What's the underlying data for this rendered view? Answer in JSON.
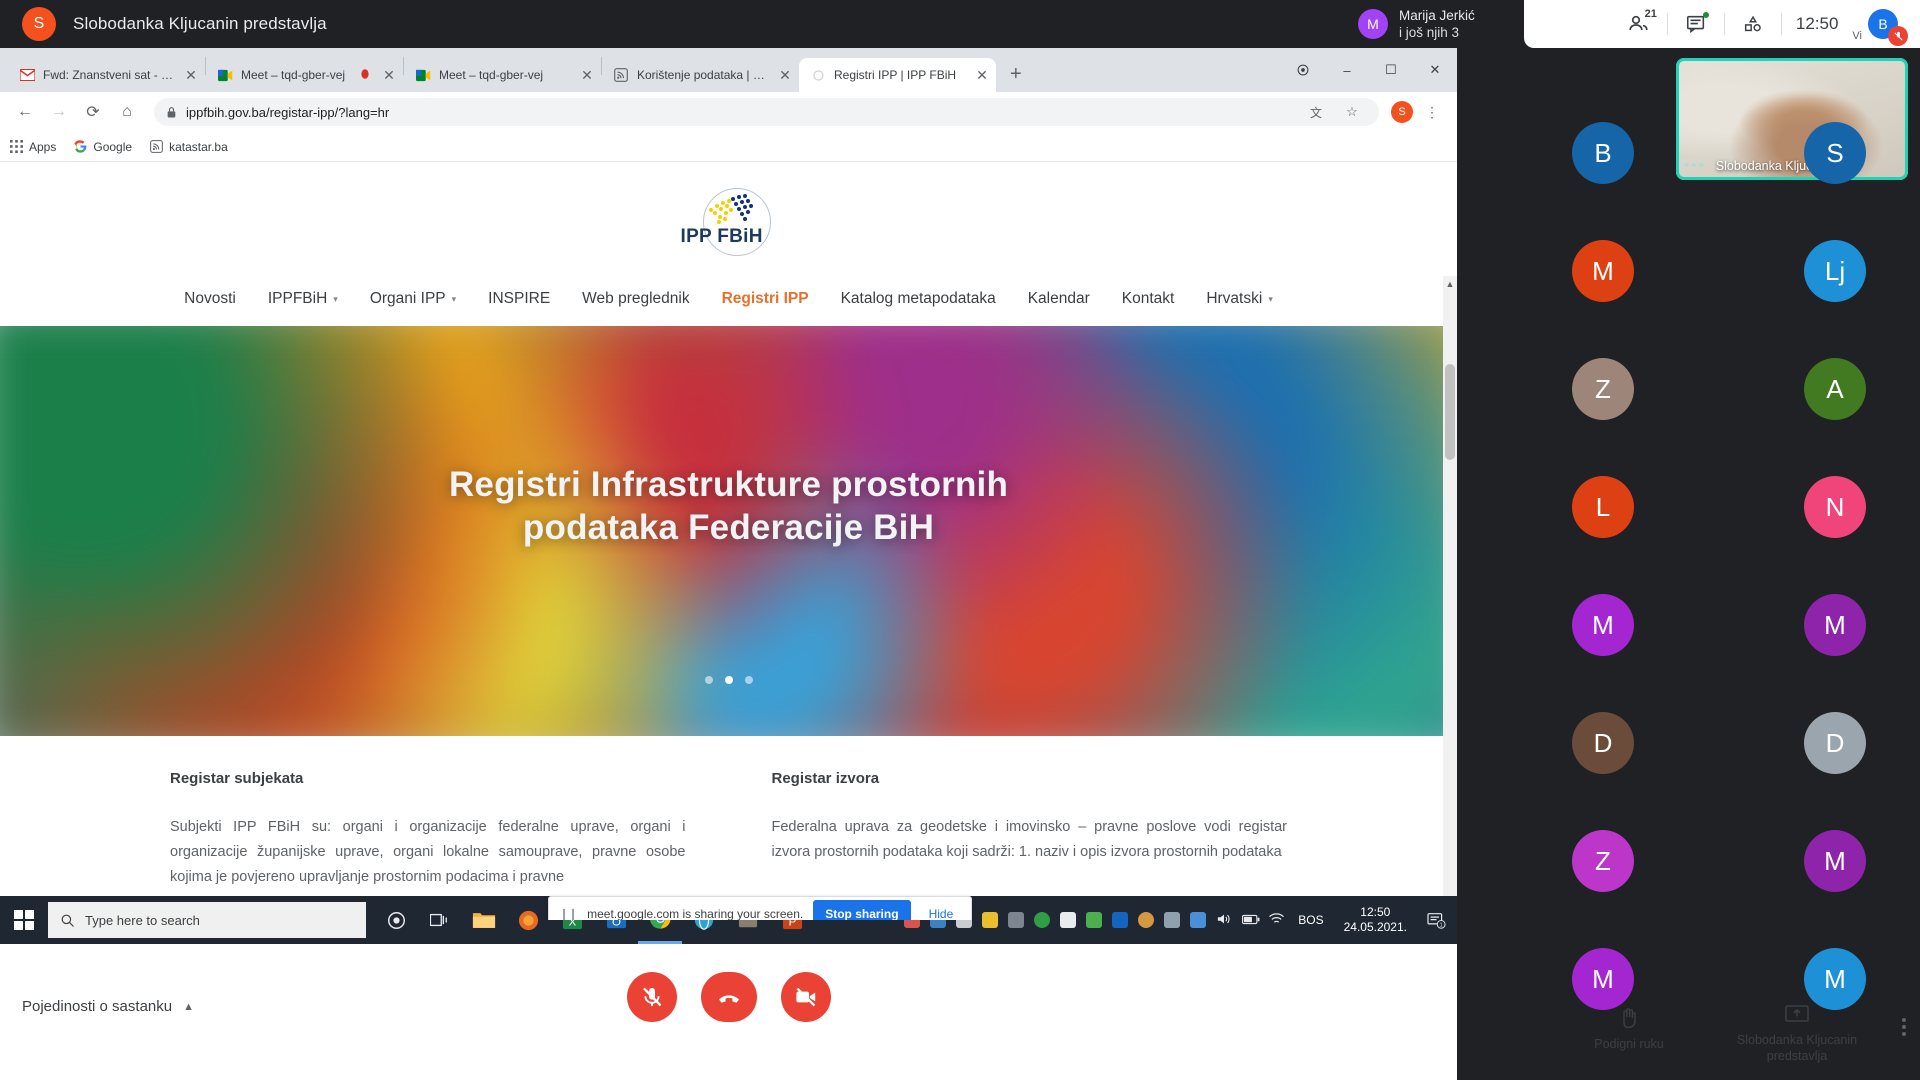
{
  "meet": {
    "presenter_banner": "Slobodanka Kljucanin predstavlja",
    "presenter_initial": "S",
    "speaker_name": "Marija Jerkić",
    "speaker_sub": "i još njih 3",
    "speaker_initial": "M",
    "participants_count": "21",
    "clock": "12:50",
    "me_label": "Vi",
    "me_initial": "B",
    "details_label": "Pojedinosti o sastanku",
    "raise_hand_label": "Podigni ruku",
    "present_label": "Slobodanka Kljucanin predstavlja",
    "selfview_name": "Slobodanka Kljucanin",
    "icons": {
      "people": "people-icon",
      "chat": "chat-icon",
      "activities": "activities-icon",
      "mic_muted": "mic-muted-icon",
      "camera_off": "camera-off-icon",
      "hangup": "hangup-icon",
      "raise_hand": "raise-hand-icon",
      "present": "present-screen-icon",
      "more": "more-options-icon"
    },
    "tiles": [
      {
        "initial": "B",
        "color": "#1565a8"
      },
      {
        "initial": "S",
        "color": "#1565a8"
      },
      {
        "initial": "M",
        "color": "#dd4012"
      },
      {
        "initial": "Lj",
        "color": "#1e90d6"
      },
      {
        "initial": "Z",
        "color": "#9e8579"
      },
      {
        "initial": "A",
        "color": "#417a21"
      },
      {
        "initial": "L",
        "color": "#dd4012"
      },
      {
        "initial": "N",
        "color": "#f0457b"
      },
      {
        "initial": "M",
        "color": "#a426d1"
      },
      {
        "initial": "M",
        "color": "#8e24aa"
      },
      {
        "initial": "D",
        "color": "#6b4c3b"
      },
      {
        "initial": "D",
        "color": "#9aa5ad"
      },
      {
        "initial": "Z",
        "color": "#bb36c9"
      },
      {
        "initial": "M",
        "color": "#8e24aa"
      },
      {
        "initial": "M",
        "color": "#a426d1"
      },
      {
        "initial": "M",
        "color": "#1e90d6"
      }
    ]
  },
  "browser": {
    "tabs": [
      {
        "title": "Fwd: Znanstveni sat - Kratki živo",
        "favicon": "gmail-icon",
        "active": false
      },
      {
        "title": "Meet – tqd-gber-vej",
        "favicon": "meet-icon",
        "active": false
      },
      {
        "title": "Meet – tqd-gber-vej",
        "favicon": "meet-icon",
        "active": false
      },
      {
        "title": "Korištenje podataka | Katastar.ba",
        "favicon": "feed-icon",
        "active": false
      },
      {
        "title": "Registri IPP | IPP FBiH",
        "favicon": "generic-icon",
        "active": true
      }
    ],
    "new_tab_label": "+",
    "window_controls": {
      "minimize": "–",
      "maximize": "☐",
      "close": "✕",
      "extra": "⊙"
    },
    "url": "ippfbih.gov.ba/registar-ipp/?lang=hr",
    "omnibox_lock": "lock-icon",
    "profile_initial": "S",
    "bookmarks": [
      {
        "label": "Apps",
        "icon": "apps-grid-icon"
      },
      {
        "label": "Google",
        "icon": "google-icon"
      },
      {
        "label": "katastar.ba",
        "icon": "feed-icon"
      }
    ],
    "share_toast": {
      "message": "meet.google.com is sharing your screen.",
      "stop_label": "Stop sharing",
      "hide_label": "Hide",
      "pause_icon": "pause-icon"
    }
  },
  "site": {
    "logo_text": "IPP FBiH",
    "nav": [
      {
        "label": "Novosti",
        "has_caret": false,
        "active": false
      },
      {
        "label": "IPPFBiH",
        "has_caret": true,
        "active": false
      },
      {
        "label": "Organi IPP",
        "has_caret": true,
        "active": false
      },
      {
        "label": "INSPIRE",
        "has_caret": false,
        "active": false
      },
      {
        "label": "Web preglednik",
        "has_caret": false,
        "active": false
      },
      {
        "label": "Registri IPP",
        "has_caret": false,
        "active": true
      },
      {
        "label": "Katalog metapodataka",
        "has_caret": false,
        "active": false
      },
      {
        "label": "Kalendar",
        "has_caret": false,
        "active": false
      },
      {
        "label": "Kontakt",
        "has_caret": false,
        "active": false
      },
      {
        "label": "Hrvatski",
        "has_caret": true,
        "active": false
      }
    ],
    "hero_title_line1": "Registri Infrastrukture prostornih",
    "hero_title_line2": "podataka Federacije BiH",
    "carousel_active_index": 1,
    "carousel_count": 3,
    "left_column": {
      "heading": "Registar subjekata",
      "body": "Subjekti IPP FBiH su: organi i organizacije federalne uprave, organi i organizacije županijske uprave, organi lokalne samouprave, pravne osobe kojima je povjereno upravljanje prostornim podacima i pravne"
    },
    "right_column": {
      "heading": "Registar izvora",
      "body": "Federalna uprava za geodetske i imovinsko – pravne poslove vodi registar izvora prostornih podataka koji sadrži: 1. naziv i opis izvora prostornih podataka"
    },
    "accent_color": "#e8702a"
  },
  "taskbar": {
    "search_placeholder": "Type here to search",
    "start_icon": "windows-start-icon",
    "search_icon": "search-icon",
    "cortana_icon": "cortana-icon",
    "task_view_icon": "task-view-icon",
    "apps": [
      {
        "name": "file-explorer-icon",
        "color": "#f5ae42"
      },
      {
        "name": "firefox-icon",
        "color": "#e86a1e"
      },
      {
        "name": "excel-icon",
        "color": "#1f8748"
      },
      {
        "name": "outlook-icon",
        "color": "#1a6ec0"
      },
      {
        "name": "chrome-icon",
        "color": "#4285f4"
      },
      {
        "name": "browser-icon",
        "color": "#2aa3d8"
      },
      {
        "name": "app-icon",
        "color": "#8a7f6d"
      },
      {
        "name": "powerpoint-icon",
        "color": "#c7431a"
      }
    ],
    "language": "BOS",
    "time": "12:50",
    "date": "24.05.2021.",
    "notification_count": "1"
  }
}
